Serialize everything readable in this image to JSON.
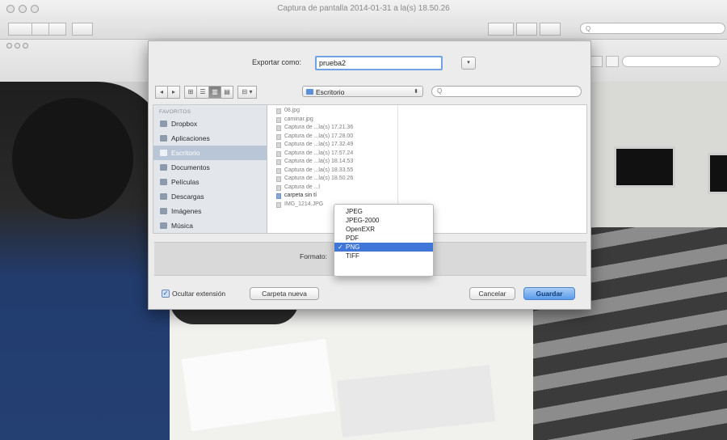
{
  "window": {
    "title": "Captura de pantalla 2014-01-31 a la(s) 18.50.26",
    "search_placeholder": "Q"
  },
  "sheet": {
    "export_label": "Exportar como:",
    "filename": "prueba2",
    "expand_glyph": "▾",
    "location": "Escritorio",
    "location_arrows": "⬍",
    "search_placeholder": "Q",
    "view_buttons": [
      "◂",
      "▸",
      "⊞",
      "☰",
      "▥",
      "▤",
      "⊟ ▾"
    ],
    "sidebar": {
      "heading": "FAVORITOS",
      "items": [
        {
          "label": "Dropbox",
          "icon": "folder-icon",
          "selected": false
        },
        {
          "label": "Aplicaciones",
          "icon": "applications-icon",
          "selected": false
        },
        {
          "label": "Escritorio",
          "icon": "desktop-icon",
          "selected": true
        },
        {
          "label": "Documentos",
          "icon": "documents-icon",
          "selected": false
        },
        {
          "label": "Películas",
          "icon": "movies-icon",
          "selected": false
        },
        {
          "label": "Descargas",
          "icon": "downloads-icon",
          "selected": false
        },
        {
          "label": "Imágenes",
          "icon": "pictures-icon",
          "selected": false
        },
        {
          "label": "Música",
          "icon": "music-icon",
          "selected": false
        }
      ]
    },
    "files": [
      {
        "name": "08.jpg",
        "type": "file"
      },
      {
        "name": "caminar.jpg",
        "type": "file"
      },
      {
        "name": "Captura de ...la(s) 17.21.36",
        "type": "file"
      },
      {
        "name": "Captura de ...la(s) 17.28.00",
        "type": "file"
      },
      {
        "name": "Captura de ...la(s) 17.32.49",
        "type": "file"
      },
      {
        "name": "Captura de ...la(s) 17.57.24",
        "type": "file"
      },
      {
        "name": "Captura de ...la(s) 18.14.53",
        "type": "file"
      },
      {
        "name": "Captura de ...la(s) 18.33.55",
        "type": "file"
      },
      {
        "name": "Captura de ...la(s) 18.50.26",
        "type": "file"
      },
      {
        "name": "Captura de ...l",
        "type": "file"
      },
      {
        "name": "carpeta sin tí",
        "type": "folder"
      },
      {
        "name": "IMG_1214.JPG",
        "type": "file"
      }
    ],
    "format_label": "Formato:",
    "format_menu": {
      "options": [
        "JPEG",
        "JPEG-2000",
        "OpenEXR",
        "PDF",
        "PNG",
        "TIFF"
      ],
      "selected": "PNG",
      "check_glyph": "✓"
    },
    "hide_extension_label": "Ocultar extensión",
    "hide_extension_checked": true,
    "new_folder_button": "Carpeta nueva",
    "cancel_button": "Cancelar",
    "save_button": "Guardar"
  },
  "colors": {
    "accent": "#3f76d8",
    "sidebar_selection": "#b8c6d8",
    "primary_button": "#5a9bea"
  }
}
